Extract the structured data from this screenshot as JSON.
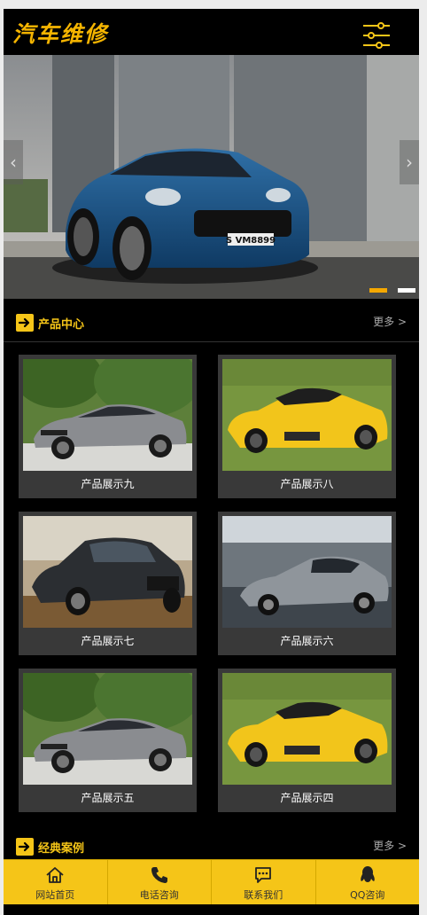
{
  "header": {
    "logo_text": "汽车维修",
    "menu_icon": "sliders-icon"
  },
  "banner": {
    "plate_text": "S VM8899",
    "slides": 2,
    "active_slide": 0,
    "prev_icon": "chevron-left-icon",
    "next_icon": "chevron-right-icon"
  },
  "products": {
    "title": "产品中心",
    "more_label": "更多 >",
    "items": [
      {
        "label": "产品展示九",
        "image": "gray-mercedes-amg"
      },
      {
        "label": "产品展示八",
        "image": "yellow-lamborghini"
      },
      {
        "label": "产品展示七",
        "image": "black-audi"
      },
      {
        "label": "产品展示六",
        "image": "gray-maserati"
      },
      {
        "label": "产品展示五",
        "image": "gray-mercedes-amg"
      },
      {
        "label": "产品展示四",
        "image": "yellow-lamborghini"
      }
    ]
  },
  "cases": {
    "title": "经典案例",
    "more_label": "更多 >"
  },
  "bottom_nav": [
    {
      "label": "网站首页",
      "icon": "home-icon"
    },
    {
      "label": "电话咨询",
      "icon": "phone-icon"
    },
    {
      "label": "联系我们",
      "icon": "chat-icon"
    },
    {
      "label": "QQ咨询",
      "icon": "qq-icon"
    }
  ],
  "colors": {
    "accent": "#f5c518",
    "logo": "#f4b400",
    "background": "#000000",
    "card": "#393939"
  }
}
